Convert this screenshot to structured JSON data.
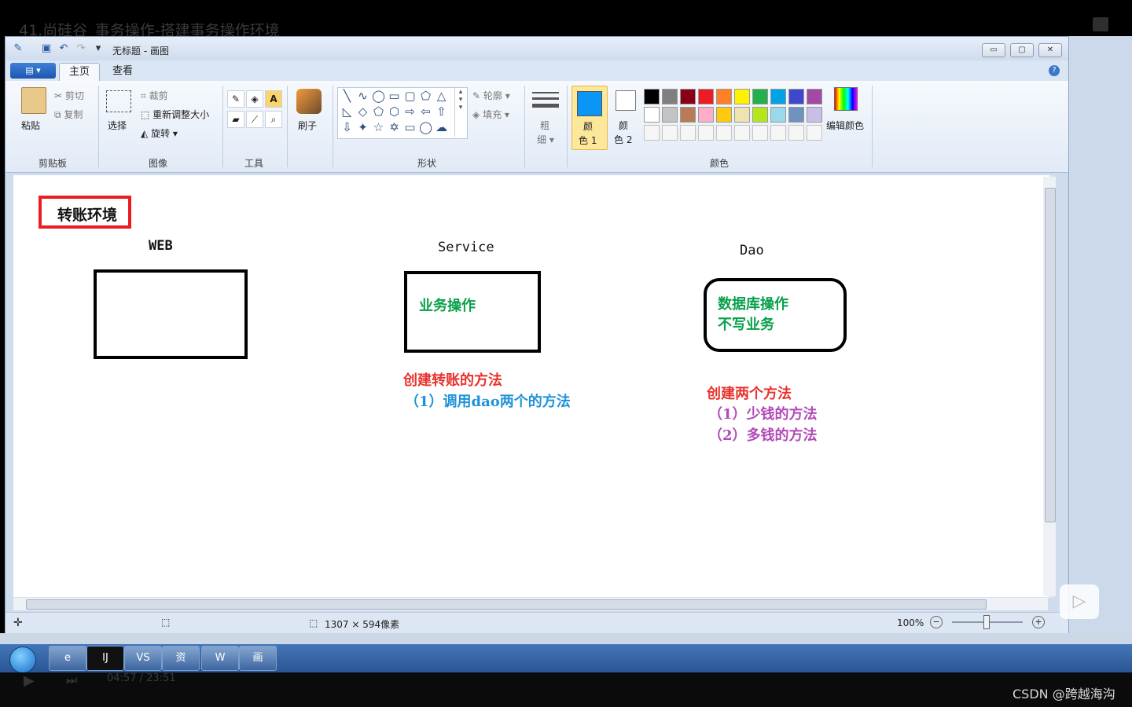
{
  "video": {
    "title": "41.尚硅谷_事务操作-搭建事务操作环境",
    "timecode": "04:57 / 23:51"
  },
  "watermark": "CSDN @跨越海沟",
  "paint": {
    "window_title": "无标题 - 画图",
    "tabs": [
      "主页",
      "查看"
    ],
    "clipboard": {
      "paste": "粘贴",
      "cut": "剪切",
      "copy": "复制",
      "group": "剪贴板"
    },
    "image": {
      "select": "选择",
      "crop": "裁剪",
      "resize": "重新调整大小",
      "rotate": "旋转",
      "group": "图像"
    },
    "tools": {
      "group": "工具"
    },
    "brushes": {
      "label": "刷子"
    },
    "shapes": {
      "outline": "轮廓",
      "fill": "填充",
      "group": "形状"
    },
    "size": {
      "label_top": "粗",
      "label_bottom": "细"
    },
    "colors": {
      "color1_top": "颜",
      "color1_bottom": "色 1",
      "color2_top": "颜",
      "color2_bottom": "色 2",
      "edit": "编辑颜色",
      "group": "颜色",
      "color1_value": "#0a96f5",
      "palette_row1": [
        "#000000",
        "#7f7f7f",
        "#880015",
        "#ed1c24",
        "#ff7f27",
        "#fff200",
        "#22b14c",
        "#00a2e8",
        "#3f48cc",
        "#a349a4"
      ],
      "palette_row2": [
        "#ffffff",
        "#c3c3c3",
        "#b97a57",
        "#ffaec9",
        "#ffc90e",
        "#efe4b0",
        "#b5e61d",
        "#99d9ea",
        "#7092be",
        "#c8bfe7"
      ]
    },
    "status": {
      "dimensions": "1307 × 594像素",
      "zoom": "100%"
    }
  },
  "drawing": {
    "heading": "转账环境",
    "layers": {
      "web": "WEB",
      "service": "Service",
      "dao": "Dao"
    },
    "service_box": "业务操作",
    "dao_box_line1": "数据库操作",
    "dao_box_line2": "不写业务",
    "service_note_title": "创建转账的方法",
    "service_note_1": "（1）调用dao两个的方法",
    "dao_note_title": "创建两个方法",
    "dao_note_1": "（1）少钱的方法",
    "dao_note_2": "（2）多钱的方法"
  },
  "taskbar": {
    "items": [
      "e",
      "IJ",
      "VS",
      "资",
      "W",
      "画"
    ]
  }
}
